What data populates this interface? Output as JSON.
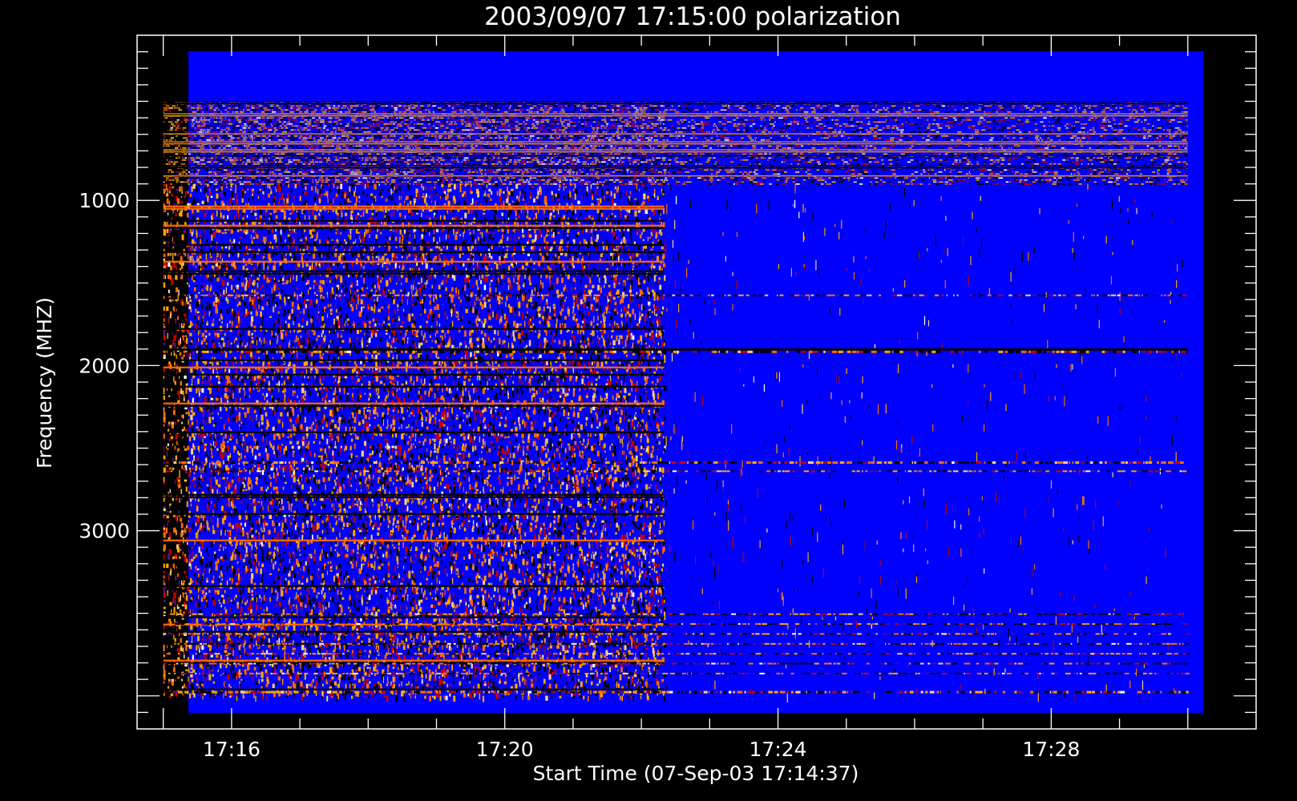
{
  "chart_data": {
    "type": "heatmap",
    "title": "2003/09/07 17:15:00 polarization",
    "xlabel": "Start Time (07-Sep-03 17:14:37)",
    "ylabel": "Frequency (MHZ)",
    "x_range": [
      "17:15:00",
      "17:30:00"
    ],
    "x_axis_range": [
      "17:14:37",
      "17:31:00"
    ],
    "y_range": [
      100,
      4000
    ],
    "y_axis_range": [
      0,
      4200
    ],
    "y_reversed": true,
    "x_ticks": [
      {
        "time": "17:16",
        "label": "17:16"
      },
      {
        "time": "17:20",
        "label": "17:20"
      },
      {
        "time": "17:24",
        "label": "17:24"
      },
      {
        "time": "17:28",
        "label": "17:28"
      }
    ],
    "y_ticks": [
      {
        "value": 1000,
        "label": "1000"
      },
      {
        "value": 2000,
        "label": "2000"
      },
      {
        "value": 3000,
        "label": "3000"
      }
    ],
    "colormap": {
      "background": "#0000ff",
      "levels": [
        "#000000",
        "#5a0c7a",
        "#c80000",
        "#ff6a00",
        "#ffa500",
        "#ffd27f",
        "#ffffff"
      ]
    },
    "features": [
      {
        "description": "dense fine-structured emission",
        "freq_range": [
          400,
          900
        ],
        "time_range": [
          "17:15:00",
          "17:30:00"
        ]
      },
      {
        "description": "broadband fluctuating emission",
        "freq_range": [
          900,
          4000
        ],
        "time_range": [
          "17:15:00",
          "17:22:20"
        ]
      },
      {
        "description": "persistent narrow-band line",
        "freq": 1900,
        "time_range": [
          "17:15:00",
          "17:30:00"
        ]
      },
      {
        "description": "persistent narrow-band line",
        "freq": 2580,
        "time_range": [
          "17:15:00",
          "17:30:00"
        ]
      },
      {
        "description": "persistent narrow-band lines",
        "freq_range": [
          3500,
          3900
        ],
        "time_range": [
          "17:15:00",
          "17:30:00"
        ]
      }
    ],
    "grid": false,
    "legend": "none"
  }
}
